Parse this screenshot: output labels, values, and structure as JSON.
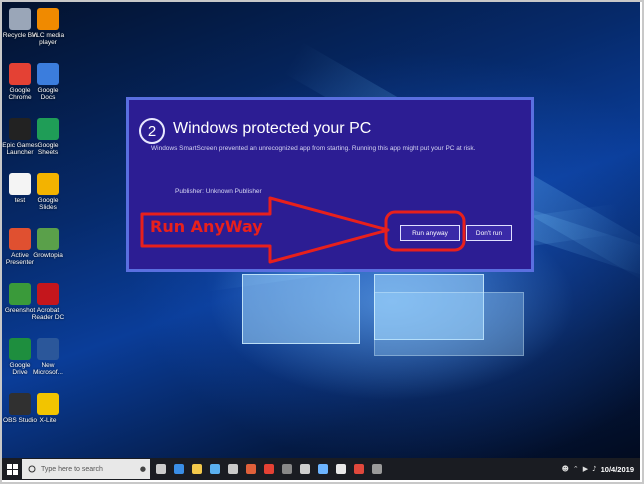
{
  "desktop_icons": [
    {
      "label": "Recycle Bin",
      "icon": "recycle-bin-icon",
      "color": "#9aa6b8"
    },
    {
      "label": "VLC media player",
      "icon": "vlc-icon",
      "color": "#f08a00"
    },
    {
      "label": "Google Chrome",
      "icon": "chrome-icon",
      "color": "#e44134"
    },
    {
      "label": "Google Docs",
      "icon": "google-docs-icon",
      "color": "#3b7ddd"
    },
    {
      "label": "Epic Games Launcher",
      "icon": "epic-games-icon",
      "color": "#222222"
    },
    {
      "label": "Google Sheets",
      "icon": "google-sheets-icon",
      "color": "#1f9d57"
    },
    {
      "label": "test",
      "icon": "text-file-icon",
      "color": "#f4f4f4"
    },
    {
      "label": "Google Slides",
      "icon": "google-slides-icon",
      "color": "#f3b300"
    },
    {
      "label": "Active Presenter",
      "icon": "active-presenter-icon",
      "color": "#e05030"
    },
    {
      "label": "Growtopia",
      "icon": "growtopia-icon",
      "color": "#5aa04a"
    },
    {
      "label": "Greenshot",
      "icon": "greenshot-icon",
      "color": "#3a9a3a"
    },
    {
      "label": "Acrobat Reader DC",
      "icon": "acrobat-icon",
      "color": "#c4161c"
    },
    {
      "label": "Google Drive",
      "icon": "google-drive-icon",
      "color": "#1e8e3e"
    },
    {
      "label": "New Microsof...",
      "icon": "word-document-icon",
      "color": "#2b579a"
    },
    {
      "label": "OBS Studio",
      "icon": "obs-icon",
      "color": "#303030"
    },
    {
      "label": "X-Lite",
      "icon": "x-lite-icon",
      "color": "#f2c400"
    }
  ],
  "dialog": {
    "step_number": "2",
    "title": "Windows protected your PC",
    "description": "Windows SmartScreen prevented an unrecognized app from starting. Running this app might put your PC at risk.",
    "publisher": "Publisher: Unknown Publisher",
    "run_button": "Run anyway",
    "dont_run_button": "Don't run",
    "bg_color": "#2c1d93"
  },
  "annotation": {
    "label": "Run AnyWay",
    "color": "#e8201c"
  },
  "taskbar": {
    "search_placeholder": "Type here to search",
    "date": "10/4/2019",
    "apps": [
      {
        "icon": "task-view-icon",
        "color": "#cccccc"
      },
      {
        "icon": "edge-icon",
        "color": "#3a8ee6"
      },
      {
        "icon": "file-explorer-icon",
        "color": "#f2c84b"
      },
      {
        "icon": "store-icon",
        "color": "#5ab0f0"
      },
      {
        "icon": "mail-icon",
        "color": "#c9c9c9"
      },
      {
        "icon": "media-icon",
        "color": "#e0603a"
      },
      {
        "icon": "chrome-icon",
        "color": "#e44134"
      },
      {
        "icon": "calculator-icon",
        "color": "#888888"
      },
      {
        "icon": "settings-icon",
        "color": "#cfcfcf"
      },
      {
        "icon": "notes-icon",
        "color": "#6cb4ff"
      },
      {
        "icon": "paint-icon",
        "color": "#e8e8e8"
      },
      {
        "icon": "snip-icon",
        "color": "#e0483c"
      },
      {
        "icon": "app-icon",
        "color": "#9a9a9a"
      }
    ]
  }
}
